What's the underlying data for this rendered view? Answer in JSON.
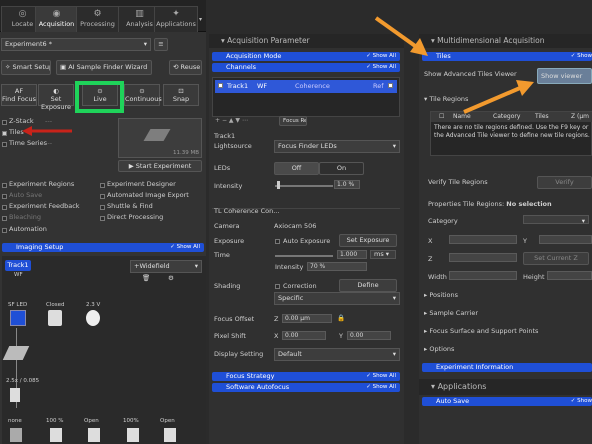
{
  "left": {
    "tabs": [
      {
        "label": "Locate",
        "icon": "locate-icon"
      },
      {
        "label": "Acquisition",
        "icon": "acquisition-icon"
      },
      {
        "label": "Processing",
        "icon": "processing-icon"
      },
      {
        "label": "Analysis",
        "icon": "analysis-icon"
      },
      {
        "label": "Applications",
        "icon": "applications-icon"
      }
    ],
    "experiment_select": "Experiment6 *",
    "smart_setup": "Smart Setup",
    "ai_wizard": "AI Sample Finder Wizard",
    "reuse": "Reuse",
    "acq_buttons": [
      "Find Focus",
      "Set Exposure",
      "Live",
      "Continuous",
      "Snap"
    ],
    "af_label": "AF",
    "dimensions": {
      "z_stack": "Z-Stack",
      "tiles": "Tiles",
      "time_series": "Time Series",
      "dashes": "---"
    },
    "size_readout": "11.39 MB",
    "start_experiment": "Start Experiment",
    "options_left": [
      "Experiment Regions",
      "Auto Save",
      "Experiment Feedback",
      "Bleaching",
      "Automation"
    ],
    "options_right": [
      "Experiment Designer",
      "Automated Image Export",
      "Shuttle & Find",
      "Direct Processing"
    ],
    "imaging_setup": "Imaging Setup",
    "show_all": "Show All",
    "track_tab": "Track1",
    "track_wf": "WF",
    "widefield": "+Widefield",
    "light_path": {
      "sf_led": "SF LED",
      "closed": "Closed",
      "volt": "2.3 V",
      "objective": "2.5x / 0.085",
      "none": "none",
      "pct1": "100 %",
      "open1": "Open",
      "pct2": "100%",
      "open2": "Open"
    }
  },
  "mid": {
    "title": "Acquisition Parameter",
    "acq_mode": "Acquisition Mode",
    "channels": "Channels",
    "channel_row": {
      "name": "Track1",
      "wf": "WF",
      "coherence": "Coherence",
      "ref": "Ref"
    },
    "focus_ref": "Focus Ref.",
    "track_title": "Track1",
    "lightsource_label": "Lightsource",
    "lightsource_value": "Focus Finder LEDs",
    "leds_label": "LEDs",
    "off": "Off",
    "on": "On",
    "intensity_label": "Intensity",
    "intensity_value": "1.0 %",
    "tl_section": "TL Coherence Con...",
    "camera_label": "Camera",
    "camera_value": "Axiocam 506",
    "exposure_label": "Exposure",
    "auto_exposure": "Auto Exposure",
    "set_exposure": "Set Exposure",
    "time_label": "Time",
    "time_value": "1.000",
    "time_unit": "ms",
    "intensity2_label": "Intensity",
    "intensity2_value": "70 %",
    "shading_label": "Shading",
    "correction": "Correction",
    "define": "Define",
    "specific": "Specific",
    "focus_offset_label": "Focus Offset",
    "z_label": "Z",
    "z_value": "0.00 µm",
    "pixel_shift_label": "Pixel Shift",
    "x_label": "X",
    "x_value": "0.00",
    "y_label": "Y",
    "y_value": "0.00",
    "display_setting_label": "Display Setting",
    "display_setting_value": "Default",
    "focus_strategy": "Focus Strategy",
    "software_autofocus": "Software Autofocus"
  },
  "right": {
    "title": "Multidimensional Acquisition",
    "tiles": "Tiles",
    "show_adv": "Show Advanced Tiles Viewer",
    "show_viewer": "Show viewer",
    "tile_regions": "Tile Regions",
    "table_headers": [
      "Name",
      "Category",
      "Tiles",
      "Z (µm"
    ],
    "empty_msg": "There are no tile regions defined. Use the F9 key or the Advanced Tile viewer to define new tile regions.",
    "verify_label": "Verify Tile Regions",
    "verify_btn": "Verify",
    "properties": "Properties Tile Regions:",
    "no_selection": "No selection",
    "category": "Category",
    "x": "X",
    "y": "Y",
    "z": "Z",
    "set_current_z": "Set Current Z",
    "width": "Width",
    "height": "Height",
    "positions": "Positions",
    "sample_carrier": "Sample Carrier",
    "focus_surface": "Focus Surface and Support Points",
    "options": "Options",
    "experiment_info": "Experiment Information",
    "applications": "Applications",
    "auto_save": "Auto Save",
    "show": "Show"
  }
}
